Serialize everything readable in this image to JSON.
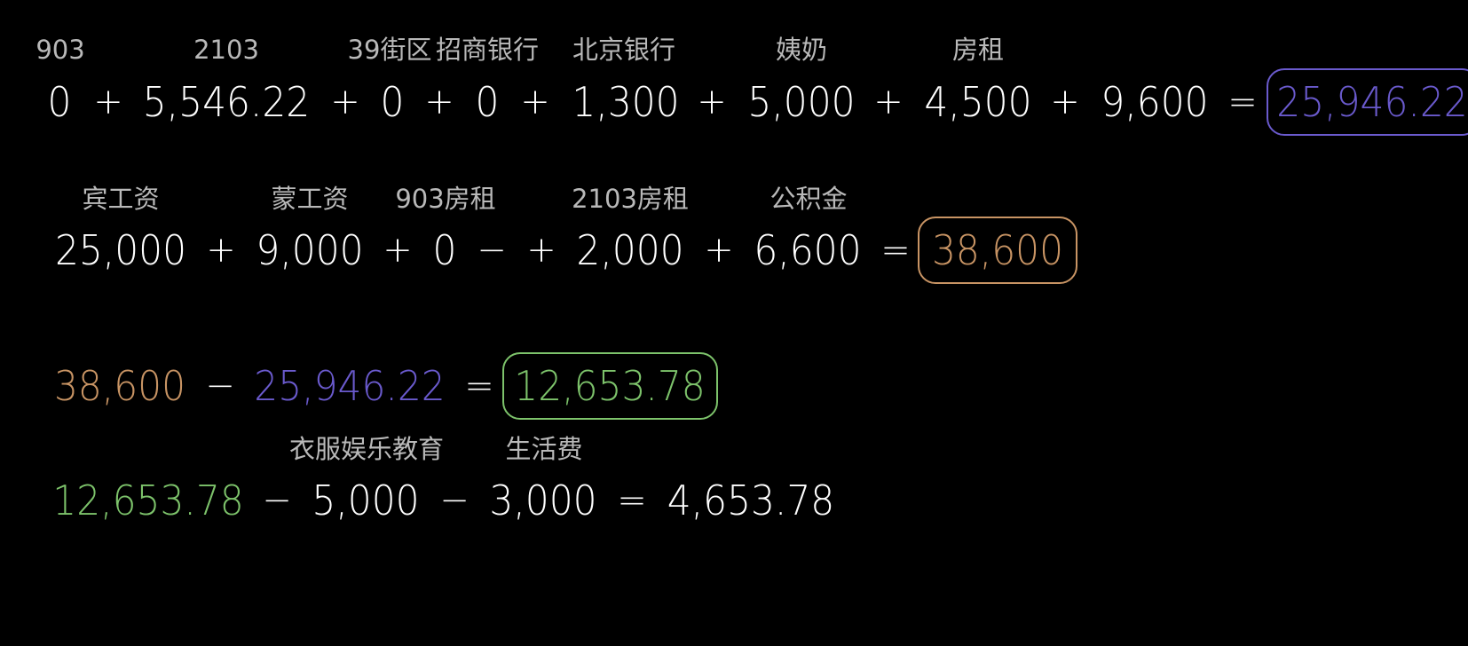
{
  "colors": {
    "background": "#000000",
    "text": "#ffffff",
    "label": "#b9b9b9",
    "purple": "#6a5acd",
    "orange": "#c89464",
    "green": "#7dc36b"
  },
  "row1": {
    "labels": [
      "903",
      "2103",
      "39街区",
      "招商银行",
      "北京银行",
      "姨奶",
      "房租"
    ],
    "values": [
      "0",
      "5,546.22",
      "0",
      "0",
      "1,300",
      "5,000",
      "4,500",
      "9,600"
    ],
    "operators": [
      "+",
      "+",
      "+",
      "+",
      "+",
      "+",
      "+",
      "="
    ],
    "total": "25,946.22"
  },
  "row2": {
    "labels": [
      "宾工资",
      "蒙工资",
      "903房租",
      "2103房租",
      "公积金"
    ],
    "values": [
      "25,000",
      "9,000",
      "0",
      "2,000",
      "6,600"
    ],
    "operators": [
      "+",
      "+",
      "−",
      "+",
      "+",
      "="
    ],
    "total": "38,600"
  },
  "row3": {
    "minuend": "38,600",
    "subtrahend": "25,946.22",
    "operators": [
      "−",
      "="
    ],
    "result": "12,653.78"
  },
  "row4": {
    "labels": [
      "衣服娱乐教育",
      "生活费"
    ],
    "start": "12,653.78",
    "values": [
      "5,000",
      "3,000"
    ],
    "operators": [
      "−",
      "−",
      "="
    ],
    "result": "4,653.78"
  }
}
